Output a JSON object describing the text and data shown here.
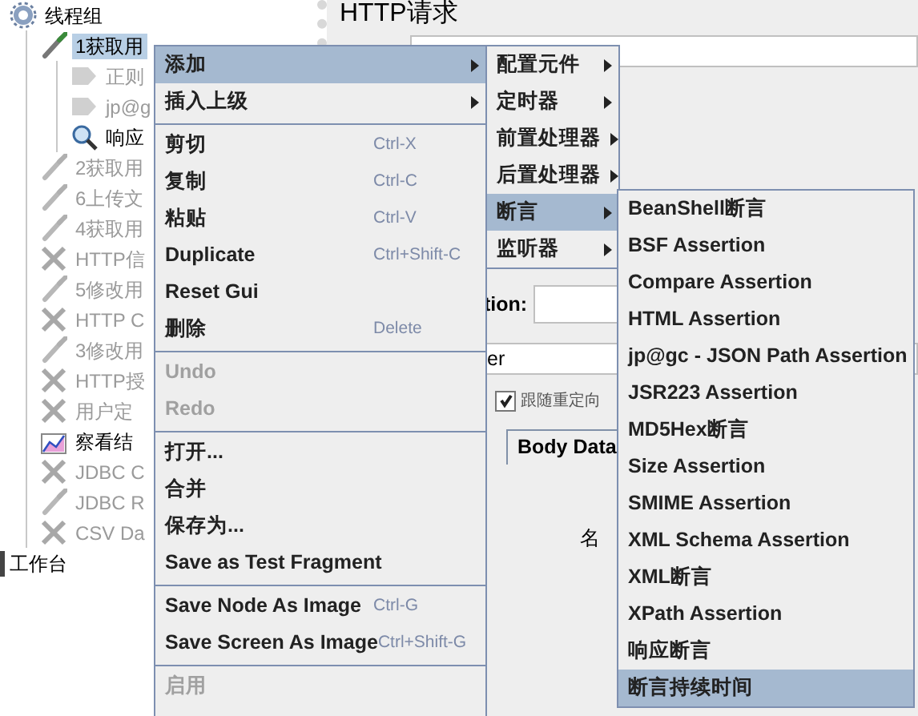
{
  "tree": {
    "label": "线程组",
    "kind": "threadgroup",
    "selected": false,
    "disabled": false,
    "children": [
      {
        "label": "1获取用",
        "kind": "sampler",
        "selected": true,
        "disabled": false,
        "children": [
          {
            "label": "正则",
            "kind": "extractor",
            "selected": false,
            "disabled": true
          },
          {
            "label": "jp@g",
            "kind": "extractor",
            "selected": false,
            "disabled": true
          },
          {
            "label": "响应",
            "kind": "assertion",
            "selected": false,
            "disabled": false
          }
        ]
      },
      {
        "label": "2获取用",
        "kind": "sampler",
        "selected": false,
        "disabled": true
      },
      {
        "label": "6上传文",
        "kind": "sampler",
        "selected": false,
        "disabled": true
      },
      {
        "label": "4获取用",
        "kind": "sampler",
        "selected": false,
        "disabled": true
      },
      {
        "label": "HTTP信",
        "kind": "config",
        "selected": false,
        "disabled": true
      },
      {
        "label": "5修改用",
        "kind": "sampler",
        "selected": false,
        "disabled": true
      },
      {
        "label": "HTTP C",
        "kind": "config",
        "selected": false,
        "disabled": true
      },
      {
        "label": "3修改用",
        "kind": "sampler",
        "selected": false,
        "disabled": true
      },
      {
        "label": "HTTP授",
        "kind": "config",
        "selected": false,
        "disabled": true
      },
      {
        "label": "用户定",
        "kind": "config",
        "selected": false,
        "disabled": true
      },
      {
        "label": "察看结",
        "kind": "listener",
        "selected": false,
        "disabled": false
      },
      {
        "label": "JDBC C",
        "kind": "config",
        "selected": false,
        "disabled": true
      },
      {
        "label": "JDBC R",
        "kind": "sampler",
        "selected": false,
        "disabled": true
      },
      {
        "label": "CSV Da",
        "kind": "config",
        "selected": false,
        "disabled": true
      }
    ]
  },
  "workbench": {
    "label": "工作台"
  },
  "panel": {
    "title": "HTTP请求",
    "field_label": "tion:",
    "field_value": "er",
    "checkbox": {
      "label": "跟随重定向",
      "checked": true
    },
    "tabs": [
      {
        "label": "Body Data",
        "selected": false
      }
    ],
    "column_header": "名"
  },
  "context_menu": {
    "items": [
      {
        "kind": "item",
        "label": "添加",
        "submenu": true,
        "selected": true,
        "disabled": false
      },
      {
        "kind": "item",
        "label": "插入上级",
        "submenu": true,
        "selected": false,
        "disabled": false
      },
      {
        "kind": "separator"
      },
      {
        "kind": "item",
        "label": "剪切",
        "shortcut": "Ctrl-X",
        "selected": false,
        "disabled": false
      },
      {
        "kind": "item",
        "label": "复制",
        "shortcut": "Ctrl-C",
        "selected": false,
        "disabled": false
      },
      {
        "kind": "item",
        "label": "粘贴",
        "shortcut": "Ctrl-V",
        "selected": false,
        "disabled": false
      },
      {
        "kind": "item",
        "label": "Duplicate",
        "shortcut": "Ctrl+Shift-C",
        "selected": false,
        "disabled": false
      },
      {
        "kind": "item",
        "label": "Reset Gui",
        "selected": false,
        "disabled": false
      },
      {
        "kind": "item",
        "label": "删除",
        "shortcut": "Delete",
        "selected": false,
        "disabled": false
      },
      {
        "kind": "separator"
      },
      {
        "kind": "item",
        "label": "Undo",
        "selected": false,
        "disabled": true
      },
      {
        "kind": "item",
        "label": "Redo",
        "selected": false,
        "disabled": true
      },
      {
        "kind": "separator"
      },
      {
        "kind": "item",
        "label": "打开...",
        "selected": false,
        "disabled": false
      },
      {
        "kind": "item",
        "label": "合并",
        "selected": false,
        "disabled": false
      },
      {
        "kind": "item",
        "label": "保存为...",
        "selected": false,
        "disabled": false
      },
      {
        "kind": "item",
        "label": "Save as Test Fragment",
        "selected": false,
        "disabled": false
      },
      {
        "kind": "separator"
      },
      {
        "kind": "item",
        "label": "Save Node As Image",
        "shortcut": "Ctrl-G",
        "selected": false,
        "disabled": false
      },
      {
        "kind": "item",
        "label": "Save Screen As Image",
        "shortcut": "Ctrl+Shift-G",
        "selected": false,
        "disabled": false
      },
      {
        "kind": "separator"
      },
      {
        "kind": "item",
        "label": "启用",
        "selected": false,
        "disabled": true
      }
    ]
  },
  "add_submenu": {
    "items": [
      {
        "kind": "item",
        "label": "配置元件",
        "submenu": true,
        "selected": false,
        "disabled": false
      },
      {
        "kind": "item",
        "label": "定时器",
        "submenu": true,
        "selected": false,
        "disabled": false
      },
      {
        "kind": "item",
        "label": "前置处理器",
        "submenu": true,
        "selected": false,
        "disabled": false
      },
      {
        "kind": "item",
        "label": "后置处理器",
        "submenu": true,
        "selected": false,
        "disabled": false
      },
      {
        "kind": "item",
        "label": "断言",
        "submenu": true,
        "selected": true,
        "disabled": false
      },
      {
        "kind": "item",
        "label": "监听器",
        "submenu": true,
        "selected": false,
        "disabled": false
      }
    ]
  },
  "assertion_submenu": {
    "items": [
      {
        "kind": "item",
        "label": "BeanShell断言",
        "selected": false,
        "disabled": false
      },
      {
        "kind": "item",
        "label": "BSF Assertion",
        "selected": false,
        "disabled": false
      },
      {
        "kind": "item",
        "label": "Compare Assertion",
        "selected": false,
        "disabled": false
      },
      {
        "kind": "item",
        "label": "HTML Assertion",
        "selected": false,
        "disabled": false
      },
      {
        "kind": "item",
        "label": "jp@gc - JSON Path Assertion",
        "selected": false,
        "disabled": false
      },
      {
        "kind": "item",
        "label": "JSR223 Assertion",
        "selected": false,
        "disabled": false
      },
      {
        "kind": "item",
        "label": "MD5Hex断言",
        "selected": false,
        "disabled": false
      },
      {
        "kind": "item",
        "label": "Size Assertion",
        "selected": false,
        "disabled": false
      },
      {
        "kind": "item",
        "label": "SMIME Assertion",
        "selected": false,
        "disabled": false
      },
      {
        "kind": "item",
        "label": "XML Schema Assertion",
        "selected": false,
        "disabled": false
      },
      {
        "kind": "item",
        "label": "XML断言",
        "selected": false,
        "disabled": false
      },
      {
        "kind": "item",
        "label": "XPath Assertion",
        "selected": false,
        "disabled": false
      },
      {
        "kind": "item",
        "label": "响应断言",
        "selected": false,
        "disabled": false
      },
      {
        "kind": "item",
        "label": "断言持续时间",
        "selected": true,
        "disabled": false
      }
    ]
  }
}
